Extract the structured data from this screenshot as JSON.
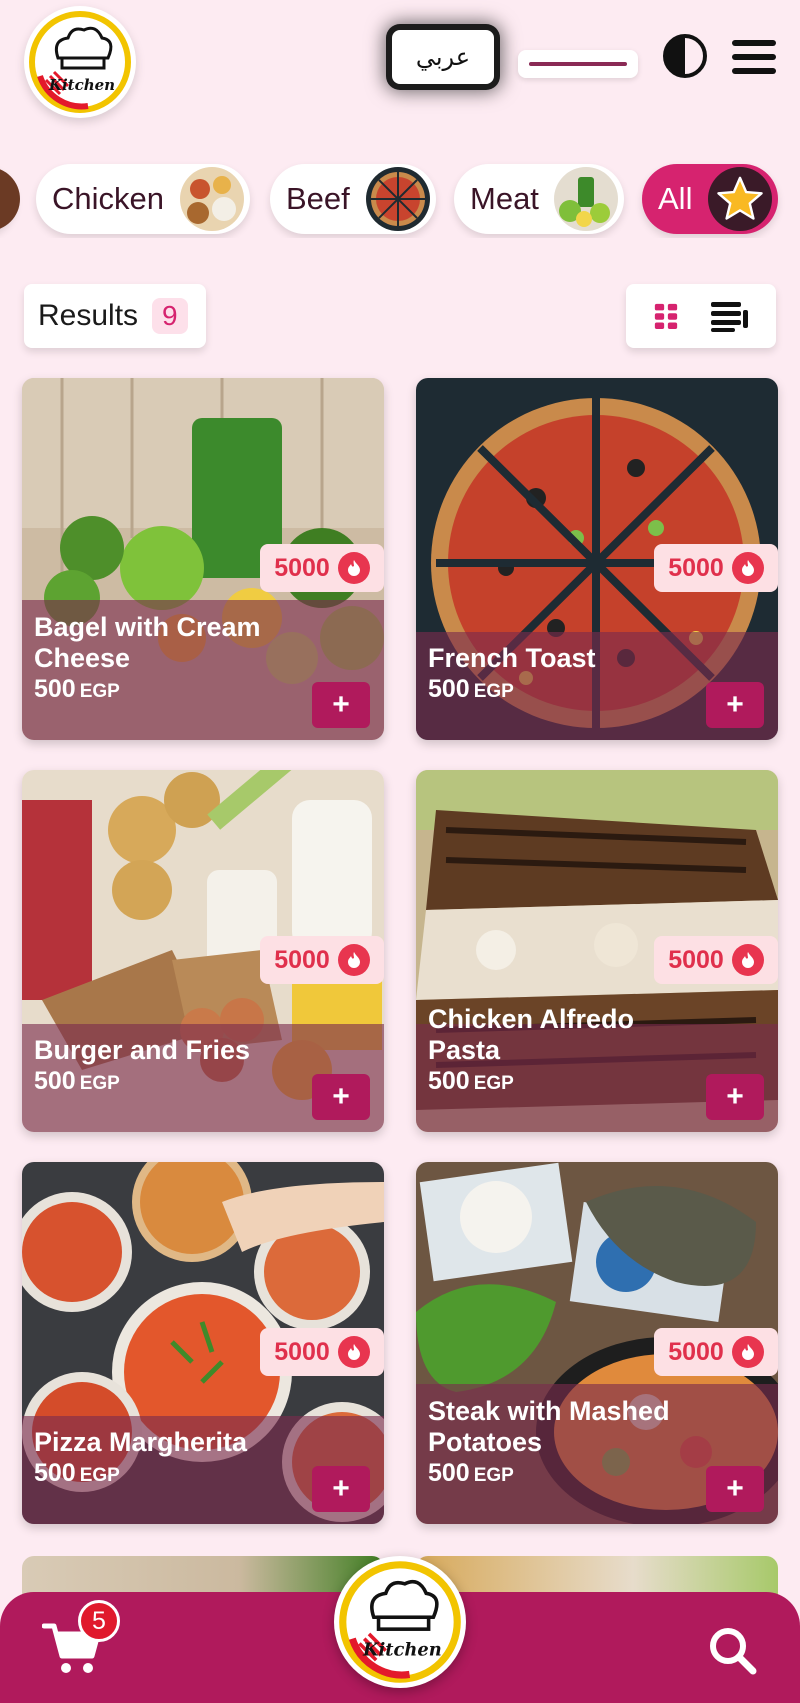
{
  "header": {
    "logo_text": "Kitchen",
    "language_label": "عربي",
    "logo_icon": "chef-hat-logo",
    "theme_icon": "contrast-icon",
    "menu_icon": "hamburger-menu-icon"
  },
  "categories": [
    {
      "label": "Chicken",
      "active": false
    },
    {
      "label": "Beef",
      "active": false
    },
    {
      "label": "Meat",
      "active": false
    },
    {
      "label": "All",
      "active": true
    }
  ],
  "results": {
    "label": "Results",
    "count": "9"
  },
  "view_toggle": {
    "grid_icon": "grid-view-icon",
    "list_icon": "list-view-icon",
    "active": "grid"
  },
  "currency": "EGP",
  "products": [
    {
      "name": "Bagel with Cream Cheese",
      "price": "500",
      "calories": "5000"
    },
    {
      "name": "French Toast",
      "price": "500",
      "calories": "5000"
    },
    {
      "name": "Burger and Fries",
      "price": "500",
      "calories": "5000"
    },
    {
      "name": "Chicken Alfredo Pasta",
      "price": "500",
      "calories": "5000"
    },
    {
      "name": "Pizza Margherita",
      "price": "500",
      "calories": "5000"
    },
    {
      "name": "Steak with Mashed Potatoes",
      "price": "500",
      "calories": "5000"
    }
  ],
  "add_label": "+",
  "bottom_nav": {
    "cart_count": "5",
    "logo_text": "Kitchen",
    "cart_icon": "cart-icon",
    "search_icon": "search-icon"
  },
  "colors": {
    "primary": "#b01a5c",
    "accent": "#d6236f",
    "background": "#fdebf2",
    "calorie": "#e0304c"
  }
}
